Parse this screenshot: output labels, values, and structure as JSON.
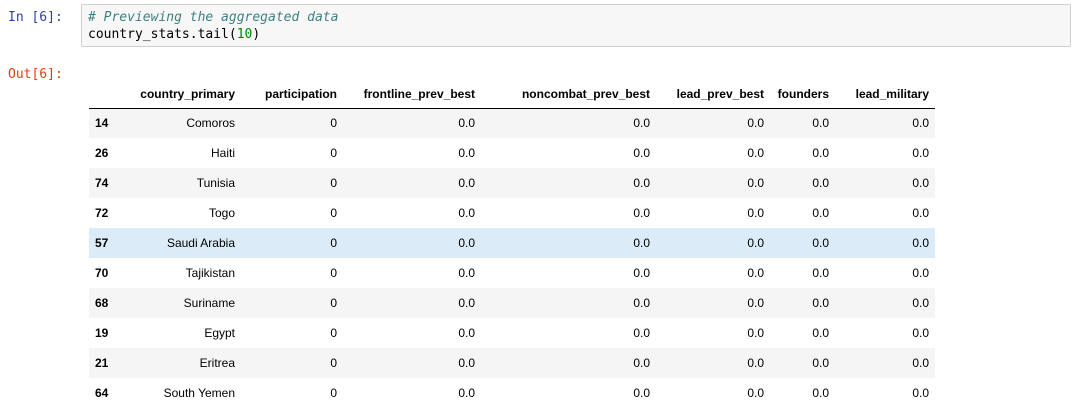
{
  "cells": {
    "in_prompt": "In [6]:",
    "out_prompt": "Out[6]:",
    "code": {
      "comment": "# Previewing the aggregated data",
      "var": "country_stats.tail(",
      "num": "10",
      "close": ")"
    }
  },
  "table": {
    "columns": [
      "",
      "country_primary",
      "participation",
      "frontline_prev_best",
      "noncombat_prev_best",
      "lead_prev_best",
      "founders",
      "lead_military"
    ],
    "rows": [
      [
        "14",
        "Comoros",
        "0",
        "0.0",
        "0.0",
        "0.0",
        "0.0",
        "0.0"
      ],
      [
        "26",
        "Haiti",
        "0",
        "0.0",
        "0.0",
        "0.0",
        "0.0",
        "0.0"
      ],
      [
        "74",
        "Tunisia",
        "0",
        "0.0",
        "0.0",
        "0.0",
        "0.0",
        "0.0"
      ],
      [
        "72",
        "Togo",
        "0",
        "0.0",
        "0.0",
        "0.0",
        "0.0",
        "0.0"
      ],
      [
        "57",
        "Saudi Arabia",
        "0",
        "0.0",
        "0.0",
        "0.0",
        "0.0",
        "0.0"
      ],
      [
        "70",
        "Tajikistan",
        "0",
        "0.0",
        "0.0",
        "0.0",
        "0.0",
        "0.0"
      ],
      [
        "68",
        "Suriname",
        "0",
        "0.0",
        "0.0",
        "0.0",
        "0.0",
        "0.0"
      ],
      [
        "19",
        "Egypt",
        "0",
        "0.0",
        "0.0",
        "0.0",
        "0.0",
        "0.0"
      ],
      [
        "21",
        "Eritrea",
        "0",
        "0.0",
        "0.0",
        "0.0",
        "0.0",
        "0.0"
      ],
      [
        "64",
        "South Yemen",
        "0",
        "0.0",
        "0.0",
        "0.0",
        "0.0",
        "0.0"
      ]
    ],
    "hover_row_index": 4
  }
}
